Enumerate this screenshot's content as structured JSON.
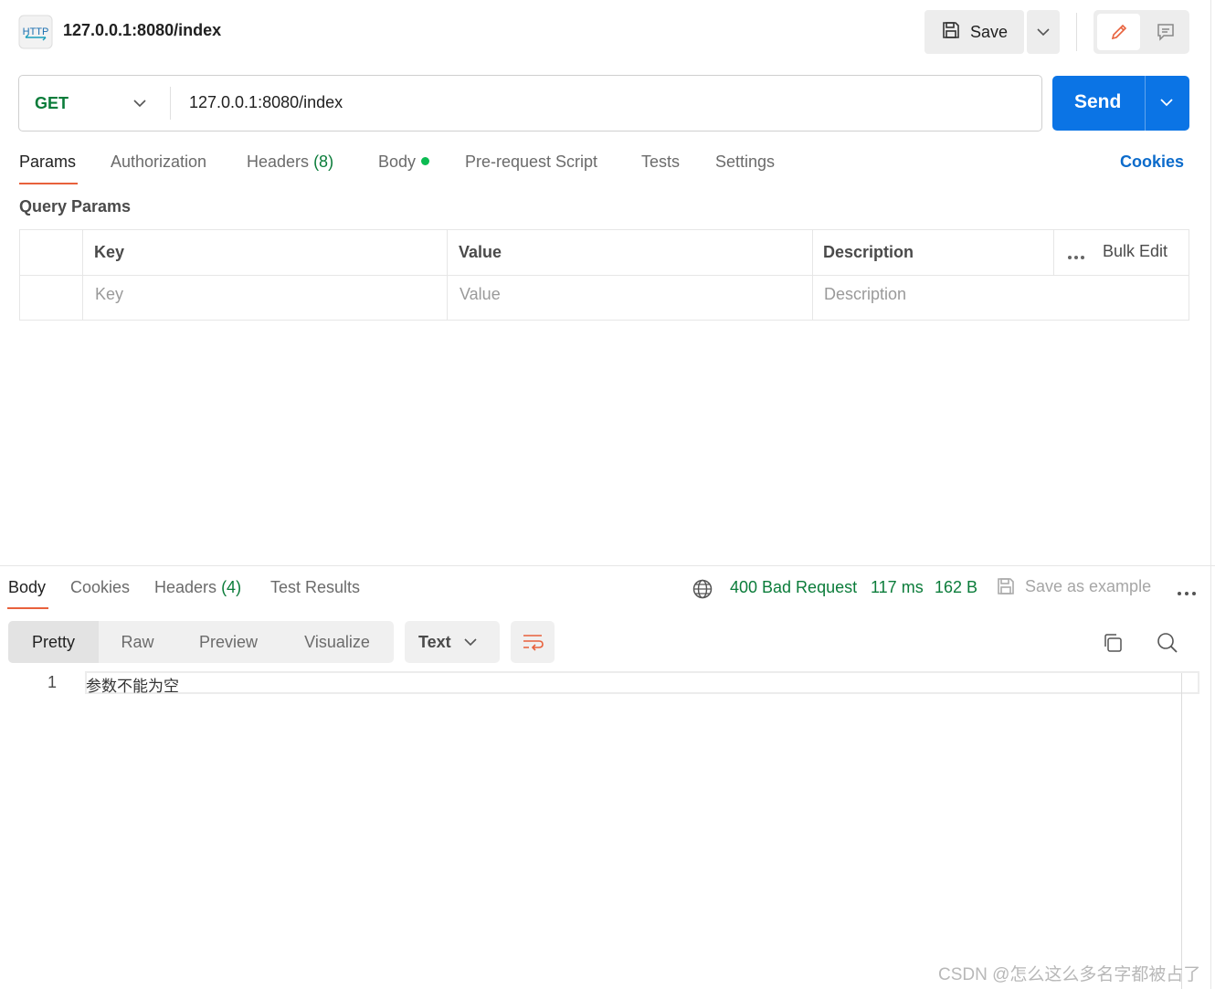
{
  "header": {
    "icon": "http-icon",
    "icon_text": "HTTP",
    "title": "127.0.0.1:8080/index",
    "save_label": "Save"
  },
  "request": {
    "method": "GET",
    "url": "127.0.0.1:8080/index",
    "send_label": "Send"
  },
  "request_tabs": {
    "params": "Params",
    "authorization": "Authorization",
    "headers_label": "Headers",
    "headers_count": "(8)",
    "body": "Body",
    "pre_request": "Pre-request Script",
    "tests": "Tests",
    "settings": "Settings",
    "cookies": "Cookies"
  },
  "query_params": {
    "title": "Query Params",
    "columns": [
      "Key",
      "Value",
      "Description"
    ],
    "bulk_edit": "Bulk Edit",
    "placeholders": [
      "Key",
      "Value",
      "Description"
    ]
  },
  "response": {
    "tabs": {
      "body": "Body",
      "cookies": "Cookies",
      "headers_label": "Headers",
      "headers_count": "(4)",
      "test_results": "Test Results"
    },
    "status": "400 Bad Request",
    "time": "117 ms",
    "size": "162 B",
    "save_example": "Save as example",
    "views": [
      "Pretty",
      "Raw",
      "Preview",
      "Visualize"
    ],
    "format": "Text",
    "lines": [
      {
        "number": "1",
        "text": "参数不能为空"
      }
    ]
  },
  "watermark": "CSDN @怎么这么多名字都被占了",
  "colors": {
    "accent": "#e8613c",
    "send": "#0b74e5",
    "success": "#0b7c3a",
    "link": "#0b6bcb"
  }
}
